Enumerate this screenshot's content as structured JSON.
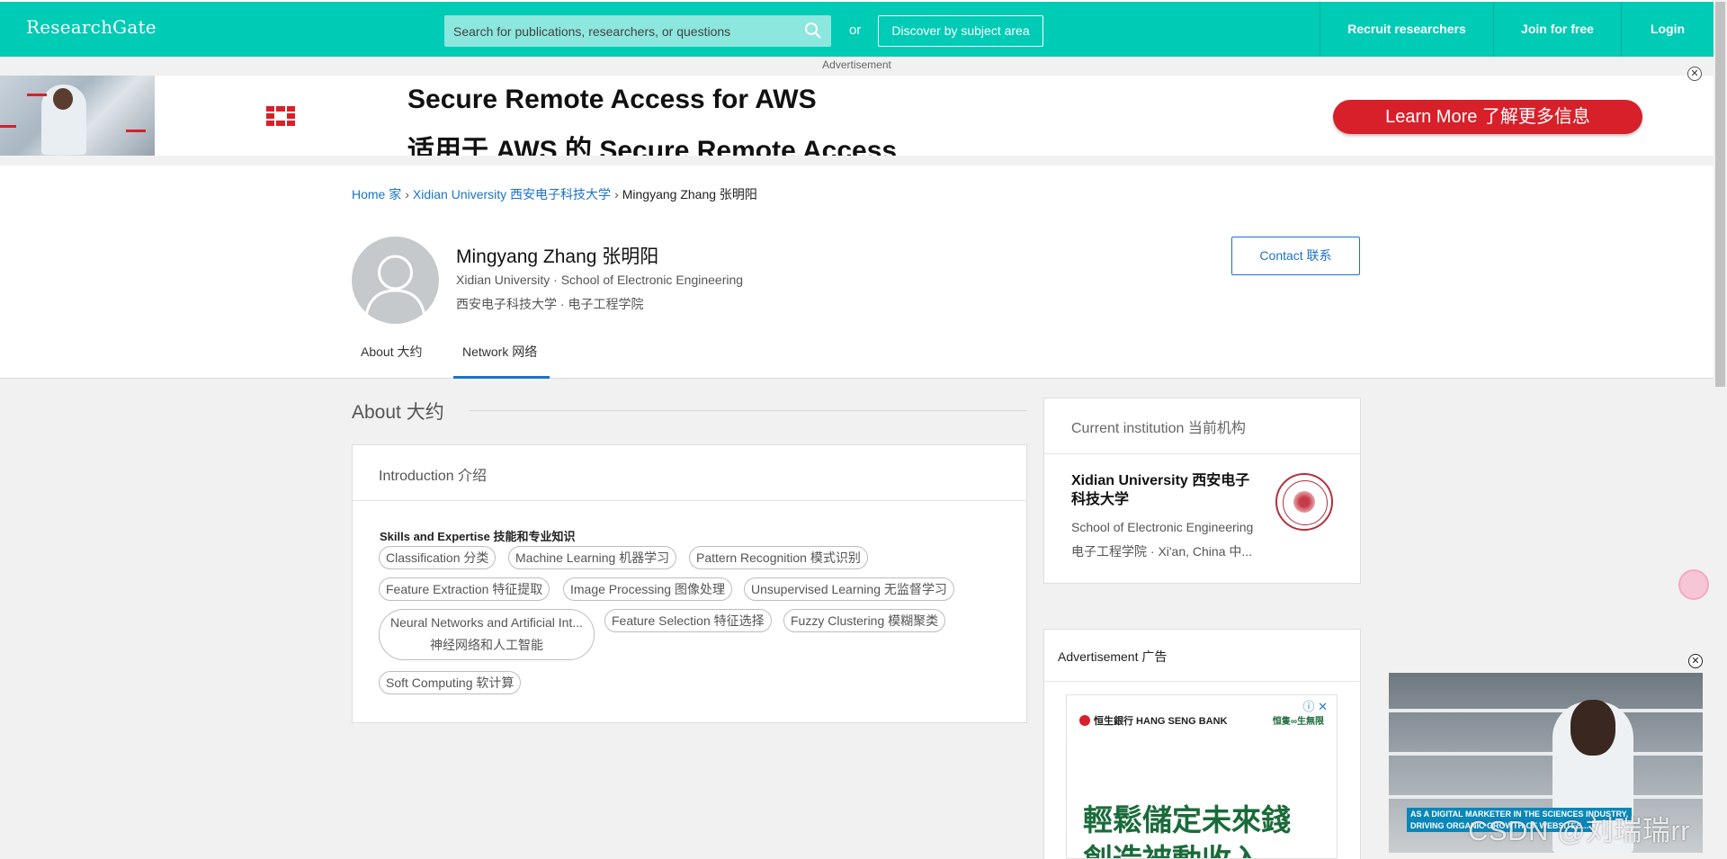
{
  "header": {
    "logo": "ResearchGate",
    "search_placeholder": "Search for publications, researchers, or questions",
    "or": "or",
    "discover": "Discover by subject area",
    "recruit": "Recruit researchers",
    "join": "Join for free",
    "login": "Login"
  },
  "top_ad": {
    "label": "Advertisement",
    "headline_en": "Secure Remote Access for AWS",
    "headline_zh": "适用于 AWS 的 Secure Remote Access",
    "cta": "Learn More  了解更多信息",
    "close": "✕",
    "info": "ⓘ"
  },
  "breadcrumb": {
    "home": "Home  家",
    "university": "Xidian University  西安电子科技大学",
    "current": "Mingyang Zhang  张明阳",
    "sep": "›"
  },
  "profile": {
    "name": "Mingyang Zhang  张明阳",
    "institution_en": "Xidian University · School of Electronic Engineering",
    "institution_zh": "西安电子科技大学 · 电子工程学院",
    "contact": "Contact  联系"
  },
  "tabs": [
    {
      "label": "About  大约",
      "active": false
    },
    {
      "label": "Network  网络",
      "active": true
    }
  ],
  "about": {
    "title": "About  大约",
    "intro_header": "Introduction  介绍",
    "skills_header": "Skills and Expertise  技能和专业知识",
    "skills": [
      "Classification  分类",
      "Machine Learning  机器学习",
      "Pattern Recognition  模式识别",
      "Feature Extraction  特征提取",
      "Image Processing  图像处理",
      "Unsupervised Learning  无监督学习",
      "Neural Networks and Artificial Int...",
      "神经网络和人工智能",
      "Feature Selection  特征选择",
      "Fuzzy Clustering  模糊聚类",
      "Soft Computing  软计算"
    ]
  },
  "institution": {
    "header": "Current institution  当前机构",
    "name": "Xidian University  西安电子科技大学",
    "school": "School of Electronic Engineering",
    "location": "电子工程学院 · Xi'an, China  中..."
  },
  "side_ad": {
    "header": "Advertisement  广告",
    "bank": "恒生銀行 HANG SENG BANK",
    "tag": "恒隻∞生無限",
    "line1": "輕鬆儲定未來錢",
    "line2": "創造被動收入",
    "close": "ⓘ ✕"
  },
  "video": {
    "caption1": "AS A DIGITAL MARKETER IN THE SCIENCES INDUSTRY,",
    "caption2": "DRIVING ORGANIC GROWTH OF WEBSITES...",
    "close": "✕"
  },
  "watermark": "CSDN @刘瑞瑞rr",
  "colors": {
    "brand": "#00cbb5",
    "link": "#1a73c9",
    "cta": "#d8202a"
  }
}
